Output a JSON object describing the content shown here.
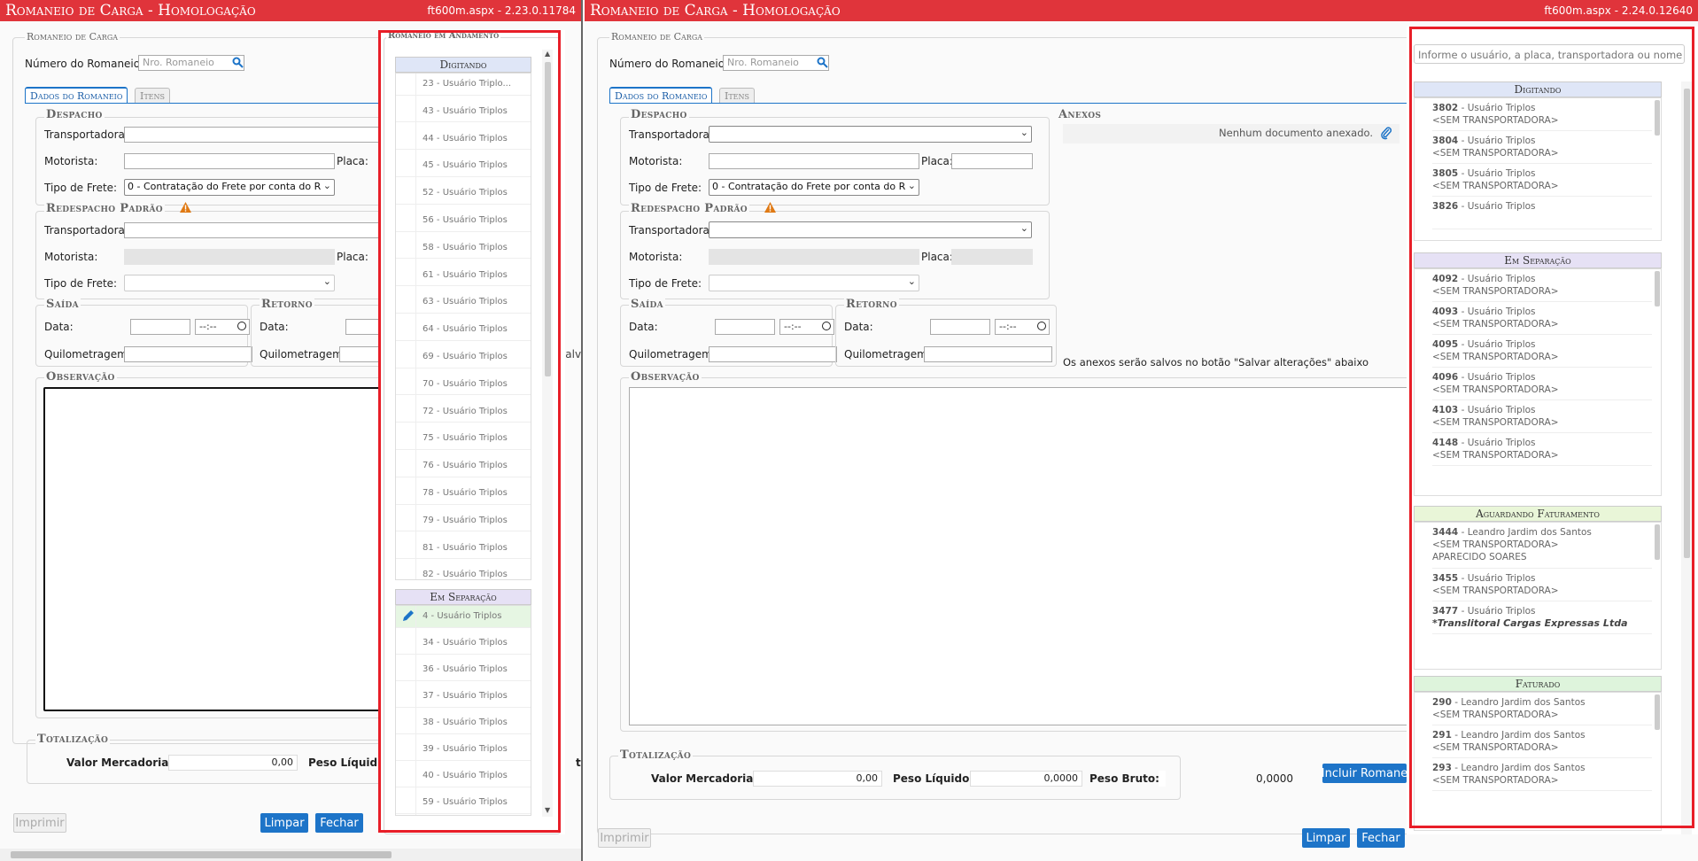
{
  "left": {
    "title": "Romaneio de Carga  - Homologação",
    "version": "ft600m.aspx - 2.23.0.11784",
    "section_title": "Romaneio de Carga",
    "numero_label": "Número do Romaneio:",
    "numero_placeholder": "Nro. Romaneio",
    "tabs": [
      "Dados do Romaneio",
      "Itens"
    ],
    "despacho": "Despacho",
    "transportadora": "Transportadora:",
    "motorista": "Motorista:",
    "placa": "Placa:",
    "tipo_frete": "Tipo de Frete:",
    "tipo_frete_value": "0 - Contratação do Frete por conta do R",
    "redespacho": "Redespacho Padrão",
    "saida": "Saída",
    "retorno": "Retorno",
    "data": "Data:",
    "time_placeholder": "--:--",
    "quilometragem": "Quilometragem:",
    "observacao": "Observação",
    "totalizacao": "Totalização",
    "valor_mercadorias": "Valor Mercadorias:",
    "valor_value": "0,00",
    "peso_liquido": "Peso Líquid",
    "salvo_fragment": "salvo",
    "te_fragment": "te",
    "imprimir": "Imprimir",
    "limpar": "Limpar",
    "fechar": "Fechar",
    "panel_title": "Romaneio em Andamento",
    "digitando": "Digitando",
    "digitando_items": [
      "23 - Usuário Triplo...",
      "43 - Usuário Triplos",
      "44 - Usuário Triplos",
      "45 - Usuário Triplos",
      "52 - Usuário Triplos",
      "56 - Usuário Triplos",
      "58 - Usuário Triplos",
      "61 - Usuário Triplos",
      "63 - Usuário Triplos",
      "64 - Usuário Triplos",
      "69 - Usuário Triplos",
      "70 - Usuário Triplos",
      "72 - Usuário Triplos",
      "75 - Usuário Triplos",
      "76 - Usuário Triplos",
      "78 - Usuário Triplos",
      "79 - Usuário Triplos",
      "81 - Usuário Triplos",
      "82 - Usuário Triplos"
    ],
    "em_separacao": "Em Separação",
    "separacao_items": [
      "4 - Usuário Triplos",
      "34 - Usuário Triplos",
      "36 - Usuário Triplos",
      "37 - Usuário Triplos",
      "38 - Usuário Triplos",
      "39 - Usuário Triplos",
      "40 - Usuário Triplos",
      "59 - Usuário Triplos"
    ]
  },
  "right": {
    "title": "Romaneio de Carga  - Homologação",
    "version": "ft600m.aspx - 2.24.0.12640",
    "section_title": "Romaneio de Carga",
    "numero_label": "Número do Romaneio:",
    "numero_placeholder": "Nro. Romaneio",
    "tabs": [
      "Dados do Romaneio",
      "Itens"
    ],
    "despacho": "Despacho",
    "transportadora": "Transportadora:",
    "motorista": "Motorista:",
    "placa": "Placa:",
    "tipo_frete": "Tipo de Frete:",
    "tipo_frete_value": "0 - Contratação do Frete por conta do R",
    "redespacho": "Redespacho Padrão",
    "anexos": "Anexos",
    "nenhum_documento": "Nenhum documento anexado.",
    "anexos_note": "Os anexos serão salvos no botão \"Salvar alterações\" abaixo",
    "saida": "Saída",
    "retorno": "Retorno",
    "data": "Data:",
    "time_placeholder": "--:--",
    "quilometragem": "Quilometragem:",
    "observacao": "Observação",
    "totalizacao": "Totalização",
    "valor_mercadorias": "Valor Mercadorias:",
    "valor_value": "0,00",
    "peso_liquido": "Peso Líquido:",
    "peso_liquido_value": "0,0000",
    "peso_bruto": "Peso Bruto:",
    "peso_bruto_value": "0,0000",
    "incluir": "Incluir Romane",
    "imprimir": "Imprimir",
    "limpar": "Limpar",
    "fechar": "Fechar",
    "search_placeholder": "Informe o usuário, a placa, transportadora ou nome d",
    "groups": [
      {
        "title": "Digitando",
        "color": "#dfe6f7",
        "items": [
          {
            "id": "3802",
            "user": "Usuário Triplos",
            "lines": [
              "<SEM TRANSPORTADORA>"
            ]
          },
          {
            "id": "3804",
            "user": "Usuário Triplos",
            "lines": [
              "<SEM TRANSPORTADORA>"
            ]
          },
          {
            "id": "3805",
            "user": "Usuário Triplos",
            "lines": [
              "<SEM TRANSPORTADORA>"
            ]
          },
          {
            "id": "3826",
            "user": "Usuário Triplos",
            "lines": []
          }
        ]
      },
      {
        "title": "Em Separação",
        "color": "#e6e1f5",
        "items": [
          {
            "id": "4092",
            "user": "Usuário Triplos",
            "lines": [
              "<SEM TRANSPORTADORA>"
            ]
          },
          {
            "id": "4093",
            "user": "Usuário Triplos",
            "lines": [
              "<SEM TRANSPORTADORA>"
            ]
          },
          {
            "id": "4095",
            "user": "Usuário Triplos",
            "lines": [
              "<SEM TRANSPORTADORA>"
            ]
          },
          {
            "id": "4096",
            "user": "Usuário Triplos",
            "lines": [
              "<SEM TRANSPORTADORA>"
            ]
          },
          {
            "id": "4103",
            "user": "Usuário Triplos",
            "lines": [
              "<SEM TRANSPORTADORA>"
            ]
          },
          {
            "id": "4148",
            "user": "Usuário Triplos",
            "lines": [
              "<SEM TRANSPORTADORA>"
            ]
          }
        ]
      },
      {
        "title": "Aguardando Faturamento",
        "color": "#e9f6d8",
        "items": [
          {
            "id": "3444",
            "user": "Leandro Jardim dos Santos",
            "lines": [
              "<SEM TRANSPORTADORA>",
              "APARECIDO SOARES"
            ]
          },
          {
            "id": "3455",
            "user": "Usuário Triplos",
            "lines": [
              "<SEM TRANSPORTADORA>"
            ]
          },
          {
            "id": "3477",
            "user": "Usuário Triplos",
            "lines": [],
            "carrier": "*Translitoral Cargas Expressas Ltda"
          }
        ]
      },
      {
        "title": "Faturado",
        "color": "#def4dc",
        "items": [
          {
            "id": "290",
            "user": "Leandro Jardim dos Santos",
            "lines": [
              "<SEM TRANSPORTADORA>"
            ]
          },
          {
            "id": "291",
            "user": "Leandro Jardim dos Santos",
            "lines": [
              "<SEM TRANSPORTADORA>"
            ]
          },
          {
            "id": "293",
            "user": "Leandro Jardim dos Santos",
            "lines": [
              "<SEM TRANSPORTADORA>"
            ]
          }
        ]
      }
    ]
  }
}
